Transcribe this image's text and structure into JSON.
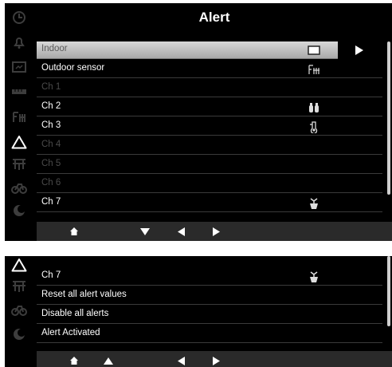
{
  "top": {
    "title": "Alert",
    "rows": [
      {
        "label": "Indoor",
        "icon": "indoor-display-icon",
        "selected": true
      },
      {
        "label": "Outdoor sensor",
        "icon": "outdoor-sensor-icon"
      },
      {
        "label": "Ch 1",
        "dimmed": true
      },
      {
        "label": "Ch 2",
        "icon": "binoculars-icon"
      },
      {
        "label": "Ch 3",
        "icon": "thermometer-icon"
      },
      {
        "label": "Ch 4",
        "dimmed": true
      },
      {
        "label": "Ch 5",
        "dimmed": true
      },
      {
        "label": "Ch 6",
        "dimmed": true
      },
      {
        "label": "Ch 7",
        "icon": "plant-pot-icon"
      }
    ]
  },
  "bottom": {
    "rows": [
      {
        "label": "Ch 7",
        "icon": "plant-pot-icon"
      },
      {
        "label": "Reset all alert values"
      },
      {
        "label": "Disable all alerts"
      },
      {
        "label": "Alert Activated"
      }
    ]
  },
  "sidebar_icons": [
    "clock-icon",
    "bell-icon",
    "display-icon",
    "ruler-icon",
    "sensor-icon",
    "alert-triangle-icon",
    "fan-icon",
    "bicycle-icon",
    "moon-icon"
  ],
  "colors": {
    "background": "#000000",
    "selected_row": "#c8c8c8",
    "dim_text": "#4a4a4a",
    "bottom_bar": "#2a2a2a"
  }
}
